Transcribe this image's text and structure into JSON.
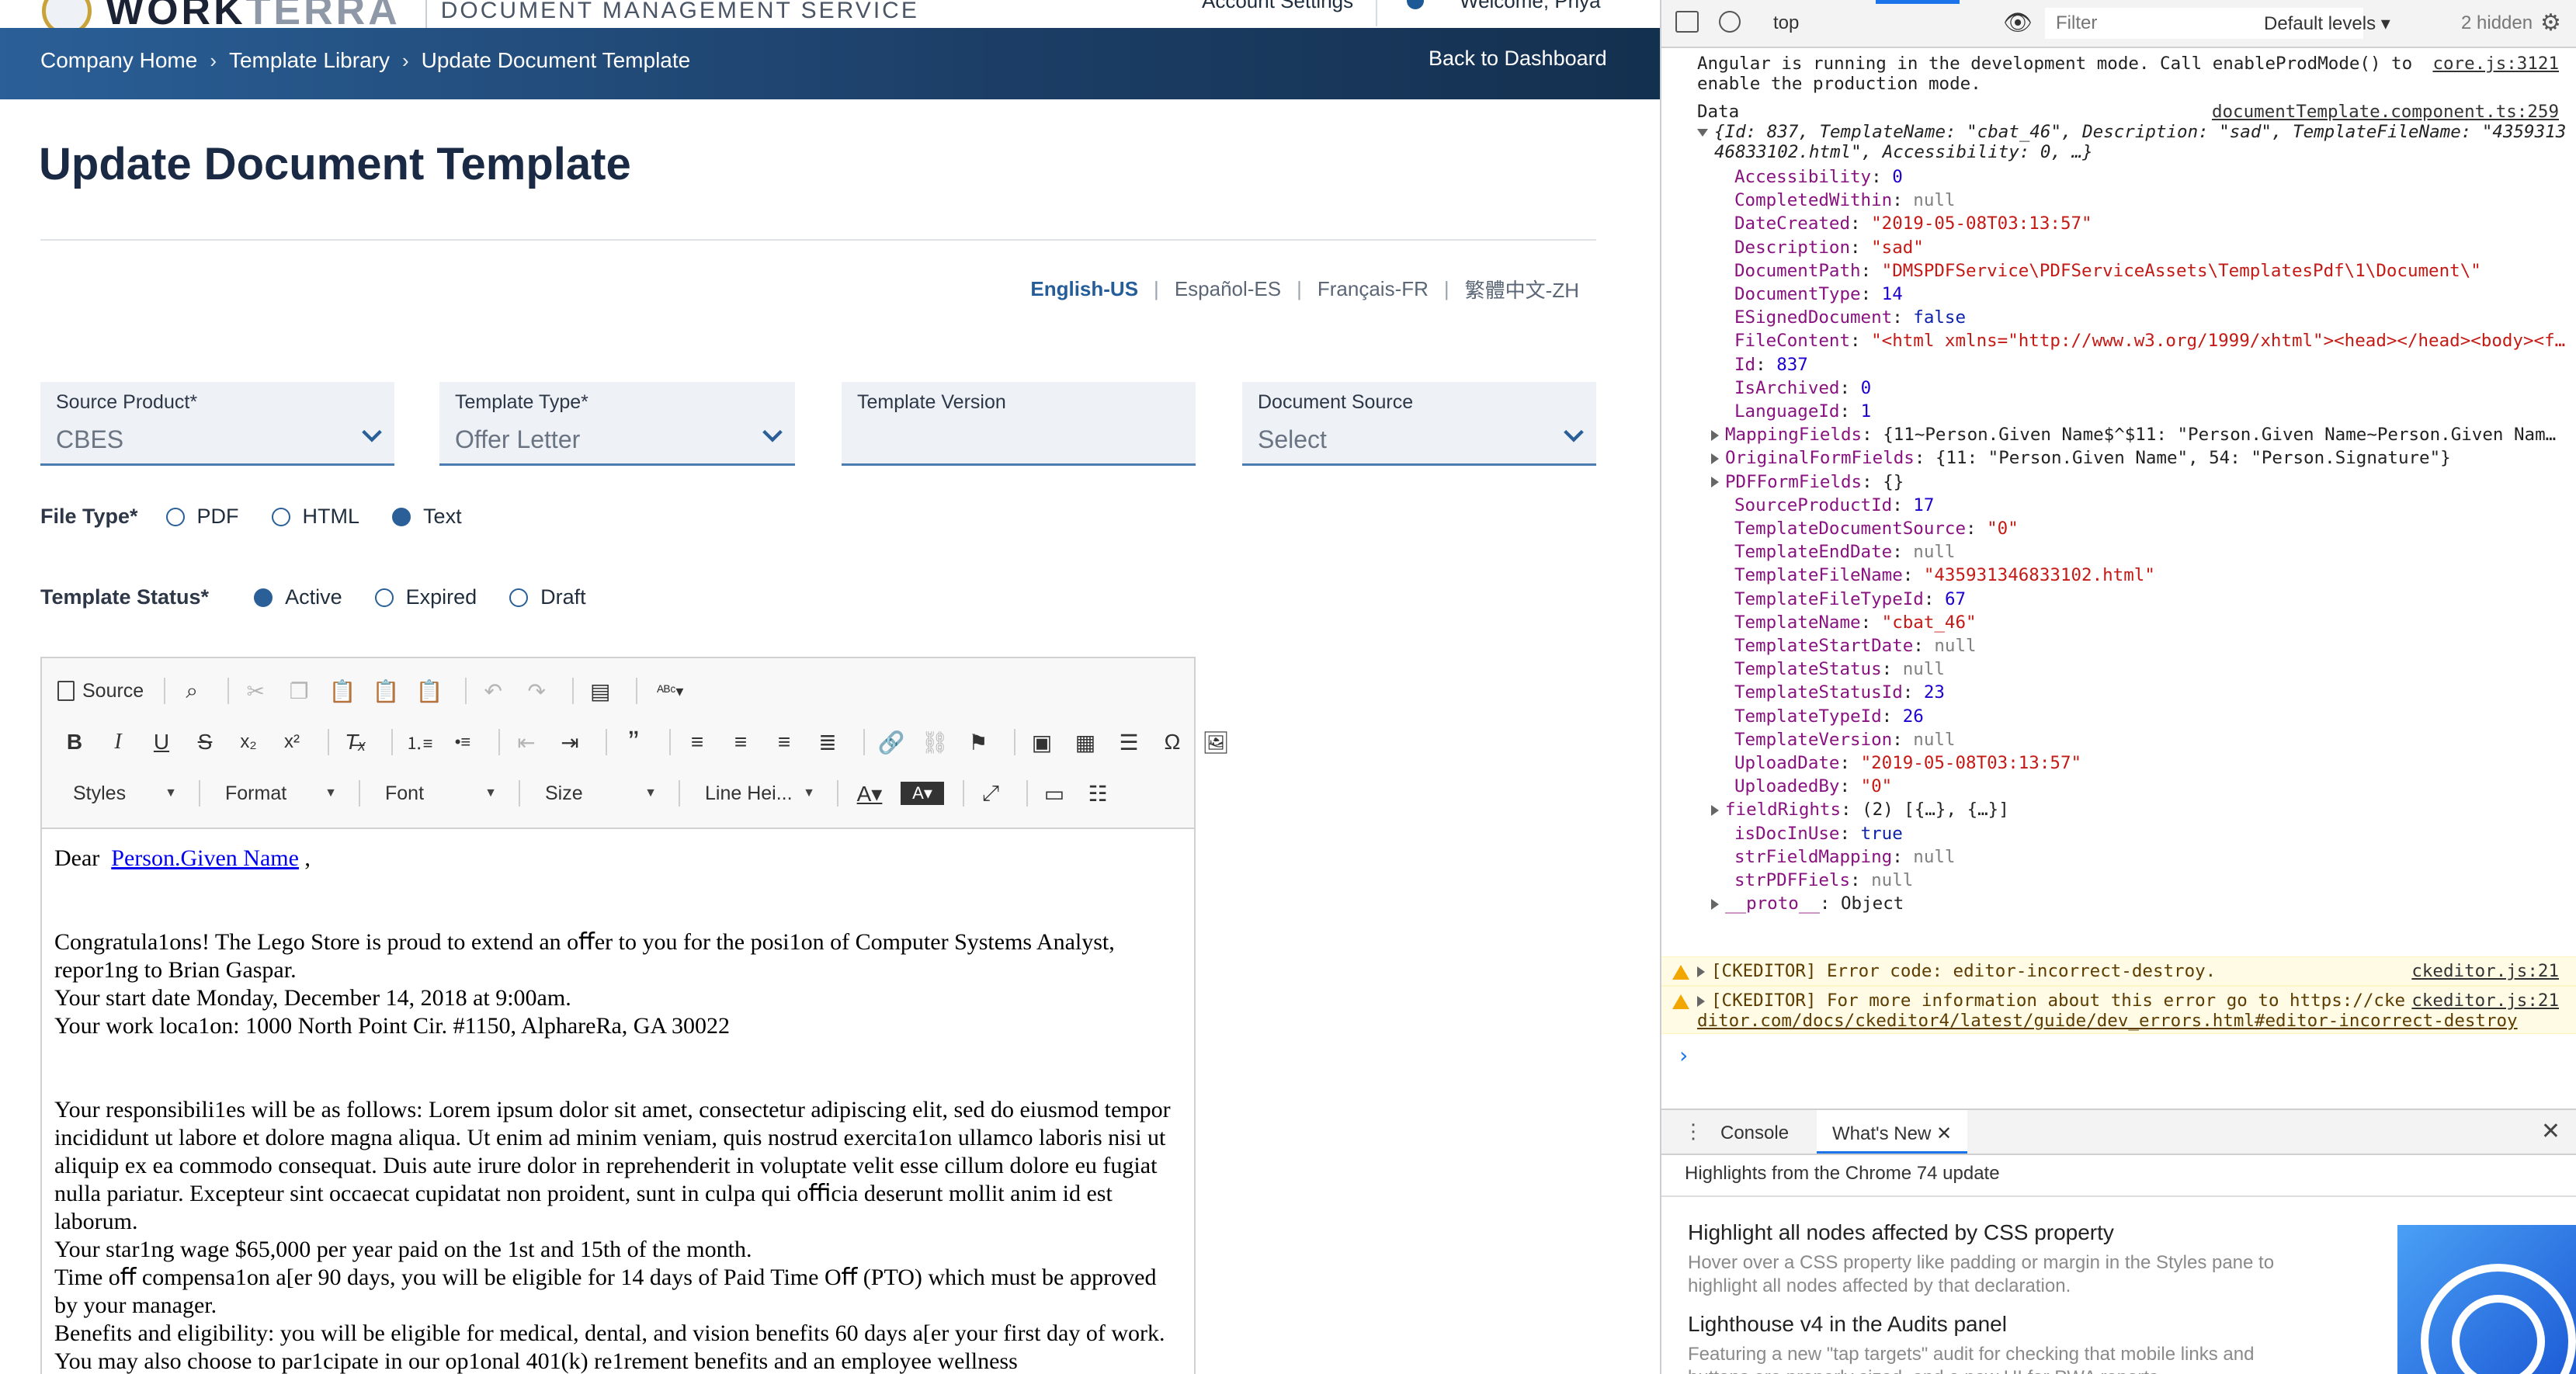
{
  "app": {
    "brand_word": "WORK",
    "brand_word_2": "TERRA",
    "service_name": "DOCUMENT MANAGEMENT SERVICE",
    "account_settings": "Account Settings",
    "welcome": "Welcome, Priya",
    "breadcrumb": [
      "Company Home",
      "Template Library",
      "Update Document Template"
    ],
    "back_link": "Back to Dashboard",
    "page_title": "Update Document Template",
    "languages": [
      "English-US",
      "Español-ES",
      "Français-FR",
      "繁體中文-ZH"
    ],
    "fields": {
      "source_product": {
        "label": "Source Product*",
        "value": "CBES"
      },
      "template_type": {
        "label": "Template Type*",
        "value": "Offer Letter"
      },
      "template_version": {
        "label": "Template Version",
        "value": ""
      },
      "document_source": {
        "label": "Document Source",
        "value": "Select"
      }
    },
    "file_type": {
      "label": "File Type*",
      "options": [
        "PDF",
        "HTML",
        "Text"
      ],
      "selected": "Text"
    },
    "template_status": {
      "label": "Template Status*",
      "options": [
        "Active",
        "Expired",
        "Draft"
      ],
      "selected": "Active"
    },
    "editor": {
      "source_label": "Source",
      "combos": [
        "Styles",
        "Format",
        "Font",
        "Size",
        "Line Hei..."
      ],
      "content": {
        "greeting_prefix": "Dear",
        "greeting_link": "Person.Given Name",
        "greeting_suffix": ",",
        "p1": "Congratula1ons! The Lego Store is proud to extend an oﬀer to you for the posi1on of Computer Systems Analyst, repor1ng to Brian Gaspar.",
        "p2": "Your start date Monday, December 14, 2018 at 9:00am.",
        "p3": "Your work loca1on: 1000 North Point Cir. #1150, AlphareRa, GA 30022",
        "p4": "Your responsibili1es will be as follows: Lorem ipsum dolor sit amet, consectetur adipiscing elit, sed do eiusmod tempor incididunt ut labore et dolore magna aliqua. Ut enim ad minim veniam, quis nostrud exercita1on ullamco laboris nisi ut aliquip ex ea commodo consequat. Duis aute irure dolor in reprehenderit in voluptate velit esse cillum dolore eu fugiat nulla pariatur. Excepteur sint occaecat cupidatat non proident, sunt in culpa qui oﬃcia deserunt mollit anim id est laborum.",
        "p5": "Your star1ng wage $65,000 per year paid on the 1st and 15th of the month.",
        "p6": "Time oﬀ compensa1on a[er 90 days, you will be eligible for 14 days of Paid Time Oﬀ (PTO) which must be approved by your manager.",
        "p7": "Benefits and eligibility: you will be eligible for medical, dental, and vision benefits 60 days a[er your first day of work. You may also choose to par1cipate in our op1onal 401(k) re1rement benefits and an employee wellness"
      }
    }
  },
  "devtools": {
    "context": "top",
    "filter_placeholder": "Filter",
    "levels": "Default levels ▾",
    "hidden": "2 hidden",
    "angular_msg_1": "Angular is running in the development mode. Call enableProdMode() to",
    "angular_msg_2": "enable the production mode.",
    "angular_src": "core.js:3121",
    "data_label": "Data",
    "data_src": "documentTemplate.component.ts:259",
    "summary_1": "{Id: 837, TemplateName: \"cbat_46\", Description: \"sad\", TemplateFileName: \"4359313",
    "summary_2": "46833102.html\", Accessibility: 0, …}",
    "props": [
      [
        "Accessibility",
        "0",
        "n"
      ],
      [
        "CompletedWithin",
        "null",
        "nl"
      ],
      [
        "DateCreated",
        "\"2019-05-08T03:13:57\"",
        "s"
      ],
      [
        "Description",
        "\"sad\"",
        "s"
      ],
      [
        "DocumentPath",
        "\"DMSPDFService\\PDFServiceAssets\\TemplatesPdf\\1\\Document\\\"",
        "s"
      ],
      [
        "DocumentType",
        "14",
        "n"
      ],
      [
        "ESignedDocument",
        "false",
        "kw"
      ],
      [
        "FileContent",
        "\"<html xmlns=\"http://www.w3.org/1999/xhtml\"><head></head><body><f…",
        "s"
      ],
      [
        "Id",
        "837",
        "n"
      ],
      [
        "IsArchived",
        "0",
        "n"
      ],
      [
        "LanguageId",
        "1",
        "n"
      ],
      [
        "MappingFields",
        "{11~Person.Given Name$^$11: \"Person.Given Name~Person.Given Nam…",
        "obj"
      ],
      [
        "OriginalFormFields",
        "{11: \"Person.Given Name\", 54: \"Person.Signature\"}",
        "obj"
      ],
      [
        "PDFFormFields",
        "{}",
        "obj"
      ],
      [
        "SourceProductId",
        "17",
        "n"
      ],
      [
        "TemplateDocumentSource",
        "\"0\"",
        "s"
      ],
      [
        "TemplateEndDate",
        "null",
        "nl"
      ],
      [
        "TemplateFileName",
        "\"435931346833102.html\"",
        "s"
      ],
      [
        "TemplateFileTypeId",
        "67",
        "n"
      ],
      [
        "TemplateName",
        "\"cbat_46\"",
        "s"
      ],
      [
        "TemplateStartDate",
        "null",
        "nl"
      ],
      [
        "TemplateStatus",
        "null",
        "nl"
      ],
      [
        "TemplateStatusId",
        "23",
        "n"
      ],
      [
        "TemplateTypeId",
        "26",
        "n"
      ],
      [
        "TemplateVersion",
        "null",
        "nl"
      ],
      [
        "UploadDate",
        "\"2019-05-08T03:13:57\"",
        "s"
      ],
      [
        "UploadedBy",
        "\"0\"",
        "s"
      ],
      [
        "fieldRights",
        "(2) [{…}, {…}]",
        "obj"
      ],
      [
        "isDocInUse",
        "true",
        "kw"
      ],
      [
        "strFieldMapping",
        "null",
        "nl"
      ],
      [
        "strPDFFiels",
        "null",
        "nl"
      ],
      [
        "__proto__",
        "Object",
        "obj"
      ]
    ],
    "warn1": "[CKEDITOR] Error code: editor-incorrect-destroy.",
    "warn1_src": "ckeditor.js:21",
    "warn2_a": "[CKEDITOR] For more information about this error go to https://cke",
    "warn2_b": "ditor.com/docs/ckeditor4/latest/guide/dev_errors.html#editor-incorrect-destroy",
    "warn2_src": "ckeditor.js:21",
    "drawer": {
      "tab_console": "Console",
      "tab_whatsnew": "What's New",
      "headline": "Highlights from the Chrome 74 update",
      "items": [
        {
          "title": "Highlight all nodes affected by CSS property",
          "desc": "Hover over a CSS property like padding or margin in the Styles pane to highlight all nodes affected by that declaration."
        },
        {
          "title": "Lighthouse v4 in the Audits panel",
          "desc": "Featuring a new \"tap targets\" audit for checking that mobile links and buttons are properly sized, and a new UI for PWA reports."
        }
      ]
    }
  }
}
